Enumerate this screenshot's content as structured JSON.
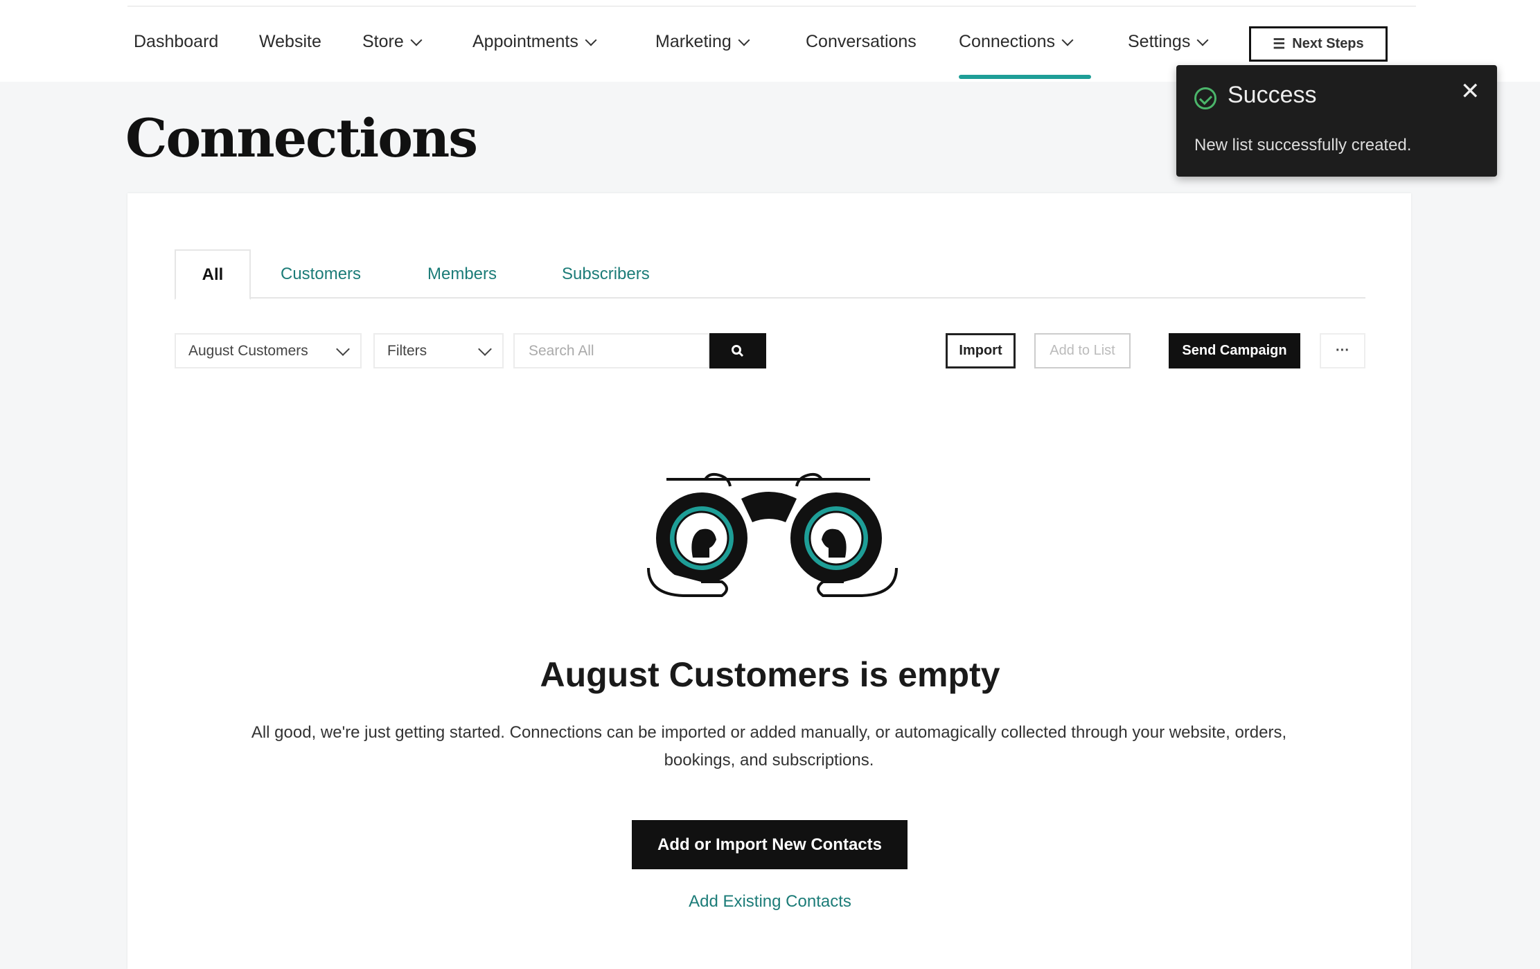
{
  "nav": {
    "items": [
      {
        "label": "Dashboard",
        "dropdown": false
      },
      {
        "label": "Website",
        "dropdown": false
      },
      {
        "label": "Store",
        "dropdown": true
      },
      {
        "label": "Appointments",
        "dropdown": true
      },
      {
        "label": "Marketing",
        "dropdown": true
      },
      {
        "label": "Conversations",
        "dropdown": false
      },
      {
        "label": "Connections",
        "dropdown": true,
        "active": true
      },
      {
        "label": "Settings",
        "dropdown": true
      }
    ],
    "next_steps": "Next Steps",
    "accent": "#1e9e97"
  },
  "page": {
    "title": "Connections"
  },
  "tabs": [
    {
      "label": "All",
      "active": true
    },
    {
      "label": "Customers"
    },
    {
      "label": "Members"
    },
    {
      "label": "Subscribers"
    }
  ],
  "toolbar": {
    "list_select": "August Customers",
    "filters": "Filters",
    "search_placeholder": "Search All",
    "import": "Import",
    "add_to_list": "Add to List",
    "send_campaign": "Send Campaign",
    "more": "···"
  },
  "empty": {
    "title": "August Customers is empty",
    "description": "All good, we're just getting started. Connections can be imported or added manually, or automagically collected through your website, orders, bookings, and subscriptions.",
    "primary": "Add or Import New Contacts",
    "secondary": "Add Existing Contacts"
  },
  "toast": {
    "title": "Success",
    "message": "New list successfully created.",
    "close": "✕",
    "success_color": "#4bb56a"
  }
}
